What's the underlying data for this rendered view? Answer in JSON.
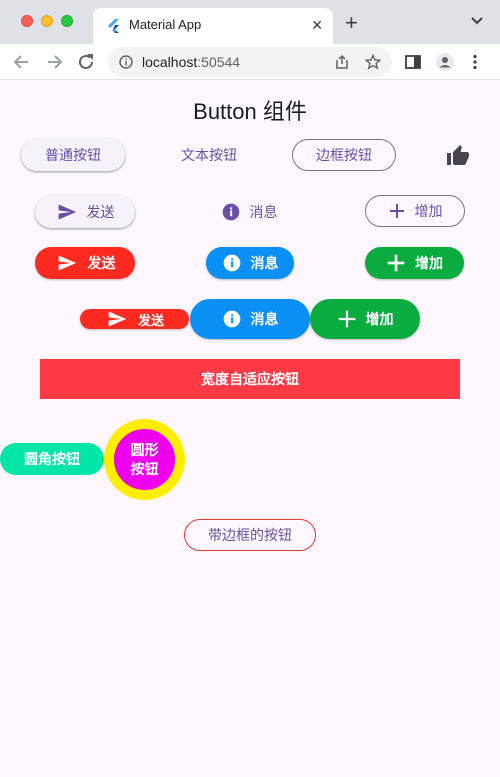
{
  "browser": {
    "tab_title": "Material App",
    "url_host": "localhost",
    "url_port": ":50544"
  },
  "page": {
    "title": "Button 组件"
  },
  "row1": {
    "elevated": "普通按钮",
    "text": "文本按钮",
    "outlined": "边框按钮"
  },
  "row2": {
    "send": "发送",
    "info": "消息",
    "add": "增加"
  },
  "row3": {
    "send": "发送",
    "info": "消息",
    "add": "增加"
  },
  "row4": {
    "send": "发送",
    "info": "消息",
    "add": "增加"
  },
  "wide_button": "宽度自适应按钮",
  "rounded_button": "圆角按钮",
  "circle_button": "圆形\n按钮",
  "bordered_button": "带边框的按钮",
  "colors": {
    "purple": "#6750a4",
    "red": "#ff2a1f",
    "blue": "#0a8ff4",
    "green": "#0aab3f",
    "wide": "#ff3a45",
    "teal": "#00e5a8",
    "magenta": "#ee00ee",
    "yellow": "#ffee00"
  }
}
